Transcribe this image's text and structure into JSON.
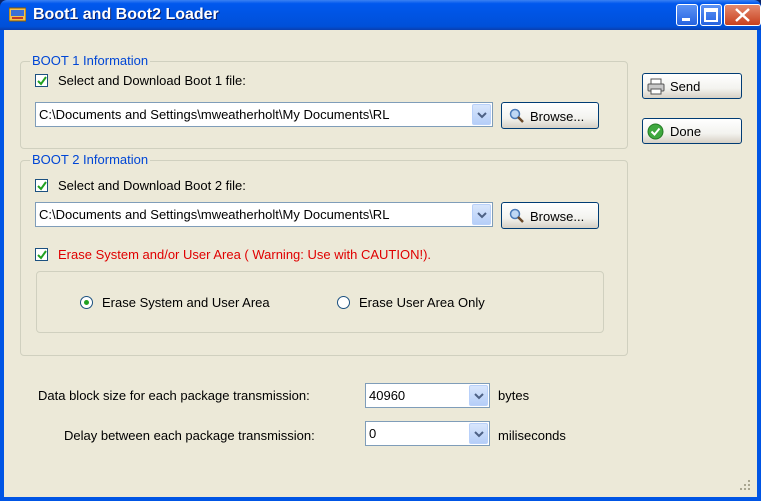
{
  "window": {
    "title": "Boot1 and Boot2 Loader"
  },
  "boot1": {
    "group_label": "BOOT 1 Information",
    "checkbox_label": "Select and Download Boot 1 file:",
    "checked": true,
    "path": "C:\\Documents and Settings\\mweatherholt\\My Documents\\RL",
    "browse_label": "Browse..."
  },
  "boot2": {
    "group_label": "BOOT 2 Information",
    "checkbox_label": "Select and Download Boot 2 file:",
    "checked": true,
    "path": "C:\\Documents and Settings\\mweatherholt\\My Documents\\RL",
    "browse_label": "Browse...",
    "erase_label": "Erase System and/or User Area ( Warning: Use with CAUTION!).",
    "erase_checked": true,
    "radio_system_user": "Erase System and User Area",
    "radio_user_only": "Erase User Area Only",
    "selected_radio": "system_user"
  },
  "buttons": {
    "send": "Send",
    "done": "Done"
  },
  "settings": {
    "block_size_label": "Data block size for each package transmission:",
    "block_size_value": "40960",
    "block_size_unit": "bytes",
    "delay_label": "Delay between each package transmission:",
    "delay_value": "0",
    "delay_unit": "miliseconds"
  },
  "colors": {
    "title_bar": "#0054E3",
    "group_legend": "#0046D5",
    "warning_text": "#E00000",
    "dialog_bg": "#ECE9D8"
  }
}
